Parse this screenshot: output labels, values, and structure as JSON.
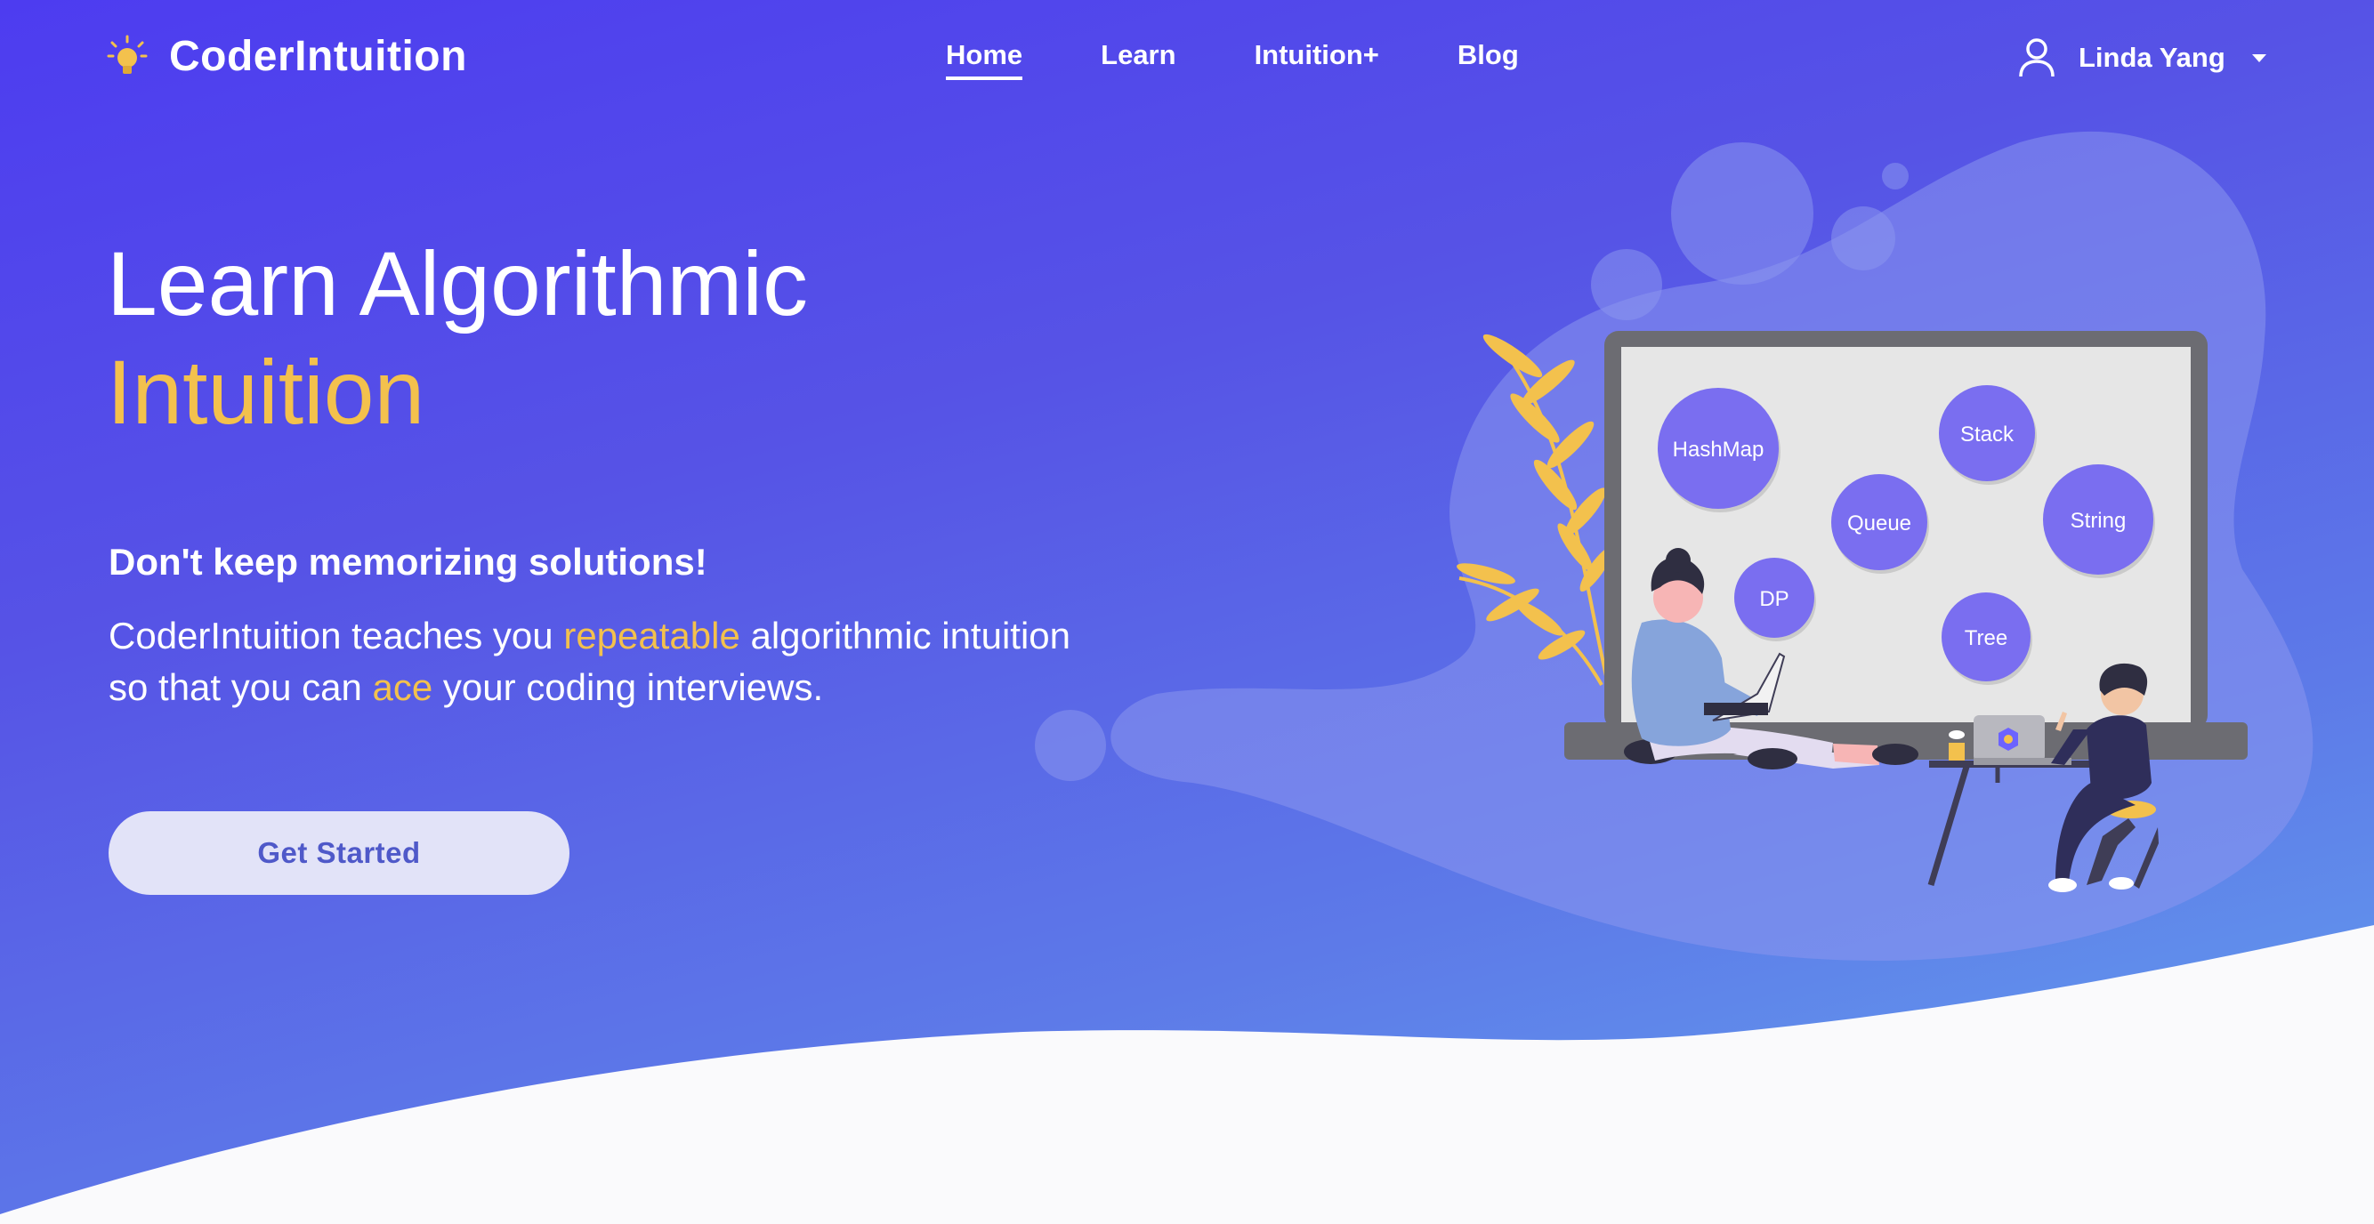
{
  "brand": {
    "name": "CoderIntuition",
    "icon": "lightbulb-icon",
    "accent": "#f3c14d"
  },
  "nav": {
    "items": [
      {
        "label": "Home",
        "active": true
      },
      {
        "label": "Learn"
      },
      {
        "label": "Intuition+"
      },
      {
        "label": "Blog"
      }
    ]
  },
  "user": {
    "name": "Linda Yang",
    "icon": "user-icon",
    "menu_icon": "caret-down-icon"
  },
  "hero": {
    "title_line1": "Learn Algorithmic",
    "title_line2": "Intuition",
    "subheading": "Don't keep memorizing solutions!",
    "paragraph": {
      "part1": "CoderIntuition teaches you ",
      "highlight1": "repeatable",
      "part2": " algorithmic intuition so that you can ",
      "highlight2": "ace",
      "part3": " your coding interviews."
    },
    "cta_label": "Get Started"
  },
  "illustration": {
    "bubbles": [
      "HashMap",
      "Stack",
      "Queue",
      "String",
      "DP",
      "Tree"
    ]
  },
  "colors": {
    "gradient_start": "#4d3cf0",
    "gradient_end": "#64a4ef",
    "button_bg": "#e2e3f8",
    "button_text": "#4f59c9",
    "bubble": "#7a6ef0"
  }
}
